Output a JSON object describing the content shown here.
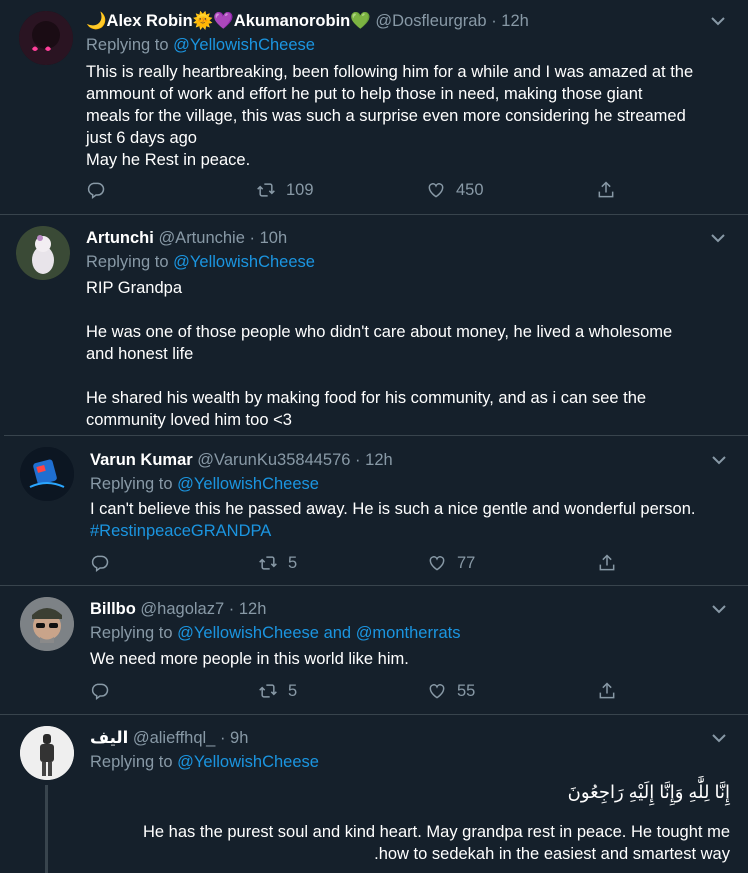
{
  "tweets": [
    {
      "name": "🌙Alex Robin🌞💜Akumanorobin💚",
      "handle": "@Dosfleurgrab",
      "time": "12h",
      "replying_prefix": "Replying to",
      "replying_to": "@YellowishCheese",
      "body": [
        "This is really heartbreaking, been following him for a while and I was amazed at the",
        "ammount of work and effort he put to help those in need, making those giant",
        "meals for the village, this was such a surprise even more considering he streamed",
        "just 6 days ago",
        "May he Rest in peace."
      ],
      "retweets": "109",
      "likes": "450"
    },
    {
      "name": "Artunchi",
      "handle": "@Artunchie",
      "time": "10h",
      "replying_prefix": "Replying to",
      "replying_to": "@YellowishCheese",
      "body": [
        "RIP Grandpa",
        "",
        "He was one of those people who didn't care about money, he lived a wholesome",
        "and honest life",
        "",
        "He shared his wealth by making food for his community, and as i can see the",
        "community loved him too <3"
      ]
    },
    {
      "name": "Varun Kumar",
      "handle": "@VarunKu35844576",
      "time": "12h",
      "replying_prefix": "Replying to",
      "replying_to": "@YellowishCheese",
      "body": [
        "I can't believe this he passed away. He is such a nice gentle and wonderful person."
      ],
      "hashtag": "#RestinpeaceGRANDPA",
      "retweets": "5",
      "likes": "77"
    },
    {
      "name": "Billbo",
      "handle": "@hagolaz7",
      "time": "12h",
      "replying_prefix": "Replying to",
      "replying_to": "@YellowishCheese",
      "replying_and": "and",
      "replying_to_2": "@montherrats",
      "body": [
        "We need more people in this world like him."
      ],
      "retweets": "5",
      "likes": "55"
    },
    {
      "name": "اليف",
      "handle": "@alieffhql_",
      "time": "9h",
      "replying_prefix": "Replying to",
      "replying_to": "@YellowishCheese",
      "arabic": "إِنَّا لِلَّٰهِ وَإِنَّا إِلَيْهِ رَاجِعُونَ",
      "body": [
        "He has the purest soul and kind heart. May grandpa rest in peace. He tought me",
        ".how to sedekah in the easiest and smartest way"
      ]
    }
  ],
  "colors": {
    "background": "#15202b",
    "link": "#1b95e0",
    "muted": "#8899a6",
    "separator": "#38444d"
  },
  "icons": [
    "reply-icon",
    "retweet-icon",
    "like-icon",
    "share-icon",
    "chevron-down-icon"
  ]
}
